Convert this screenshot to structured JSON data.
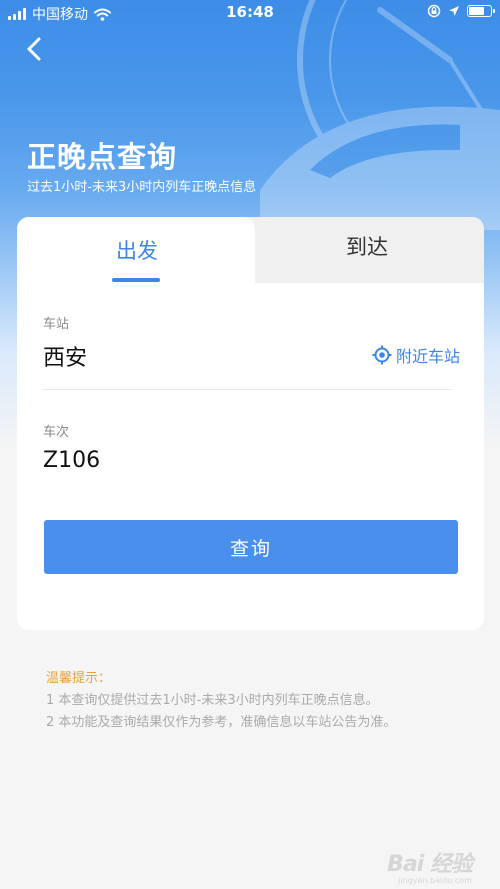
{
  "status_bar": {
    "carrier": "中国移动",
    "time": "16:48",
    "icons": [
      "signal-bars-icon",
      "wifi-icon",
      "lock-rotation-icon",
      "location-arrow-icon",
      "battery-icon"
    ]
  },
  "header": {
    "back_icon": "chevron-left-icon",
    "title": "正晚点查询",
    "subtitle": "过去1小时-未来3小时内列车正晚点信息"
  },
  "tabs": [
    {
      "label": "出发",
      "active": true
    },
    {
      "label": "到达",
      "active": false
    }
  ],
  "form": {
    "station": {
      "label": "车站",
      "value": "西安",
      "nearby_label": "附近车站",
      "nearby_icon": "locate-target-icon"
    },
    "train": {
      "label": "车次",
      "value": "Z106"
    },
    "submit_label": "查询"
  },
  "tips": {
    "title": "温馨提示：",
    "lines": [
      "1 本查询仅提供过去1小时-未来3小时内列车正晚点信息。",
      "2 本功能及查询结果仅作为参考，准确信息以车站公告为准。"
    ]
  },
  "watermark": {
    "logo": "Bai 经验",
    "url": "jingyan.baidu.com"
  },
  "colors": {
    "accent": "#3c86e6",
    "button": "#4b8fed",
    "tip_title": "#e8a33d",
    "hero_top": "#3d8de8"
  }
}
